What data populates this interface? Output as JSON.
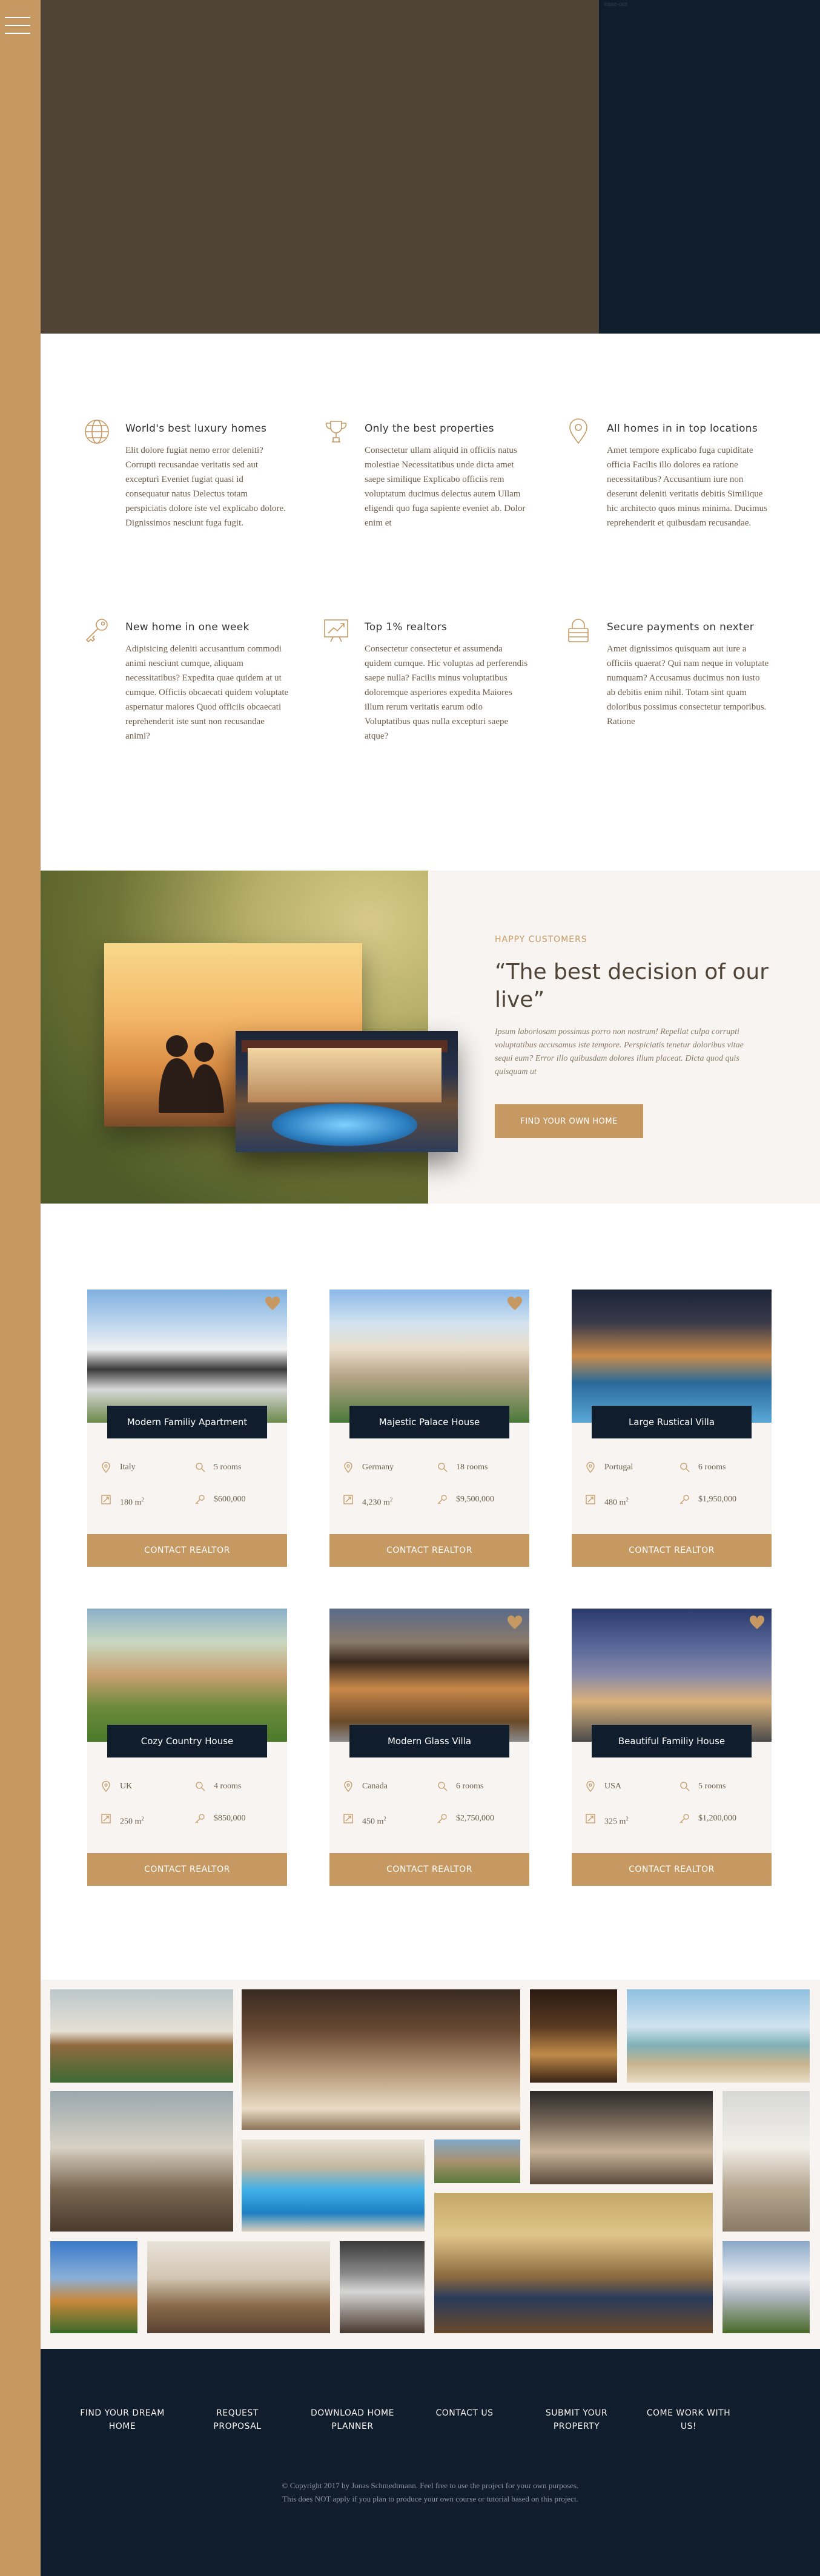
{
  "hero": {
    "top_right_note": "ease-out"
  },
  "features": [
    {
      "icon": "globe-icon",
      "title": "World's best luxury homes",
      "text": "Elit dolore fugiat nemo error deleniti? Corrupti recusandae veritatis sed aut excepturi Eveniet fugiat quasi id consequatur natus Delectus totam perspiciatis dolore iste vel explicabo dolore. Dignissimos nesciunt fuga fugit."
    },
    {
      "icon": "trophy-icon",
      "title": "Only the best properties",
      "text": "Consectetur ullam aliquid in officiis natus molestiae Necessitatibus unde dicta amet saepe similique Explicabo officiis rem voluptatum ducimus delectus autem Ullam eligendi quo fuga sapiente eveniet ab. Dolor enim et"
    },
    {
      "icon": "map-pin-icon",
      "title": "All homes in in top locations",
      "text": "Amet tempore explicabo fuga cupiditate officia Facilis illo dolores ea ratione necessitatibus? Accusantium iure non deserunt deleniti veritatis debitis Similique hic architecto quos minus minima. Ducimus reprehenderit et quibusdam recusandae."
    },
    {
      "icon": "key-icon",
      "title": "New home in one week",
      "text": "Adipisicing deleniti accusantium commodi animi nesciunt cumque, aliquam necessitatibus? Expedita quae quidem at ut cumque. Officiis obcaecati quidem voluptate aspernatur maiores Quod officiis obcaecati reprehenderit iste sunt non recusandae animi?"
    },
    {
      "icon": "chart-up-icon",
      "title": "Top 1% realtors",
      "text": "Consectetur consectetur et assumenda quidem cumque. Hic voluptas ad perferendis saepe nulla? Facilis minus voluptatibus doloremque asperiores expedita Maiores illum rerum veritatis earum odio Voluptatibus quas nulla excepturi saepe atque?"
    },
    {
      "icon": "lock-icon",
      "title": "Secure payments on nexter",
      "text": "Amet dignissimos quisquam aut iure a officiis quaerat? Qui nam neque in voluptate numquam? Accusamus ducimus non iusto ab debitis enim nihil. Totam sint quam doloribus possimus consectetur temporibus. Ratione"
    }
  ],
  "story": {
    "eyebrow": "HAPPY CUSTOMERS",
    "title": "“The best decision of our live”",
    "body": "Ipsum laboriosam possimus porro non nostrum! Repellat culpa corrupti voluptatibus accusamus iste tempore. Perspiciatis tenetur doloribus vitae sequi eum? Error illo quibusdam dolores illum placeat. Dicta quod quis quisquam ut",
    "button": "FIND YOUR OWN HOME"
  },
  "homes": [
    {
      "name": "Modern Familiy Apartment",
      "country": "Italy",
      "rooms": "5 rooms",
      "area": "180 m",
      "price": "$600,000",
      "button": "CONTACT REALTOR",
      "liked": true
    },
    {
      "name": "Majestic Palace House",
      "country": "Germany",
      "rooms": "18 rooms",
      "area": "4,230 m",
      "price": "$9,500,000",
      "button": "CONTACT REALTOR",
      "liked": true
    },
    {
      "name": "Large Rustical Villa",
      "country": "Portugal",
      "rooms": "6 rooms",
      "area": "480 m",
      "price": "$1,950,000",
      "button": "CONTACT REALTOR",
      "liked": false
    },
    {
      "name": "Cozy Country House",
      "country": "UK",
      "rooms": "4 rooms",
      "area": "250 m",
      "price": "$850,000",
      "button": "CONTACT REALTOR",
      "liked": false
    },
    {
      "name": "Modern Glass Villa",
      "country": "Canada",
      "rooms": "6 rooms",
      "area": "450 m",
      "price": "$2,750,000",
      "button": "CONTACT REALTOR",
      "liked": true
    },
    {
      "name": "Beautiful Familiy House",
      "country": "USA",
      "rooms": "5 rooms",
      "area": "325 m",
      "price": "$1,200,000",
      "button": "CONTACT REALTOR",
      "liked": true
    }
  ],
  "area_unit_sup": "2",
  "footer": {
    "links": [
      "FIND YOUR DREAM HOME",
      "REQUEST PROPOSAL",
      "DOWNLOAD HOME PLANNER",
      "CONTACT US",
      "SUBMIT YOUR PROPERTY",
      "COME WORK WITH US!"
    ],
    "copyright_line1": "© Copyright 2017 by Jonas Schmedtmann. Feel free to use the project for your own purposes.",
    "copyright_line2": "This does NOT apply if you plan to produce your own course or tutorial based on this project."
  },
  "colors": {
    "primary": "#c69963",
    "dark": "#101d2c",
    "hero_brown": "#4f4436",
    "light": "#f7f4f1"
  }
}
